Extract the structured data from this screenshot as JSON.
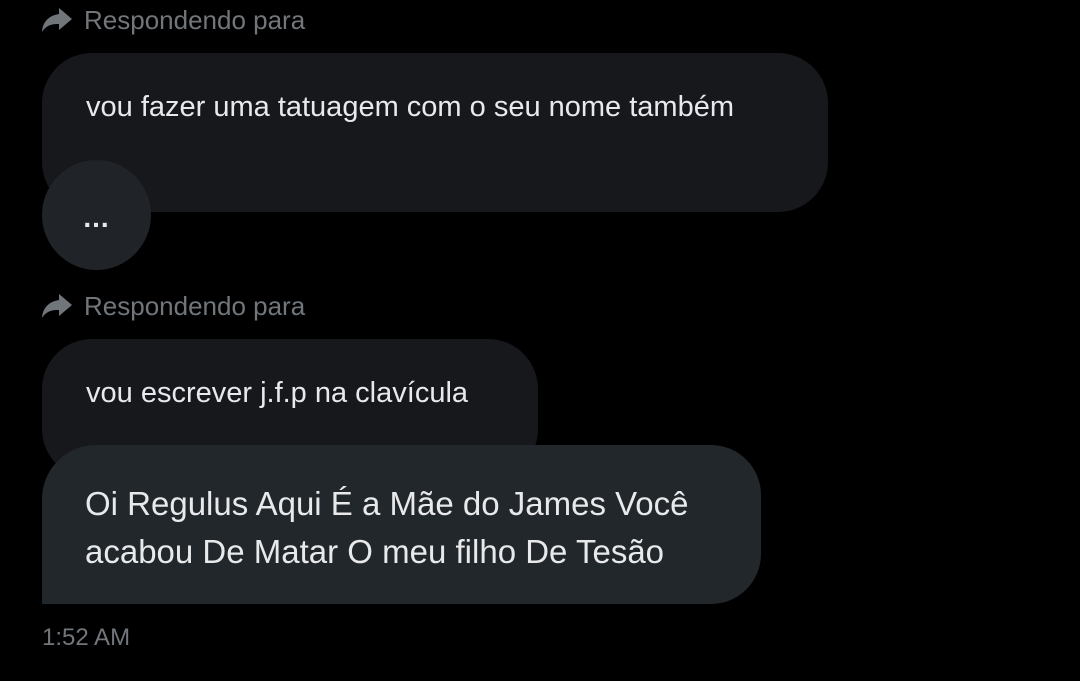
{
  "colors": {
    "background": "#000000",
    "bubble_dark": "#16181c",
    "bubble_highlight": "#22272c",
    "secondary_text": "#71767b",
    "primary_text": "#e7e9ea"
  },
  "messages": [
    {
      "reply_label": "Respondendo para",
      "reply_icon": "reply-arrow-icon",
      "text": "vou fazer uma tatuagem com o seu nome também",
      "more_label": "..."
    },
    {
      "reply_label": "Respondendo para",
      "reply_icon": "reply-arrow-icon",
      "text": "vou escrever j.f.p na clavícula"
    },
    {
      "lines": [
        "Oi Regulus Aqui É a Mãe do James Você",
        "acabou De Matar O meu filho De Tesão"
      ]
    }
  ],
  "timestamp": "1:52 AM"
}
